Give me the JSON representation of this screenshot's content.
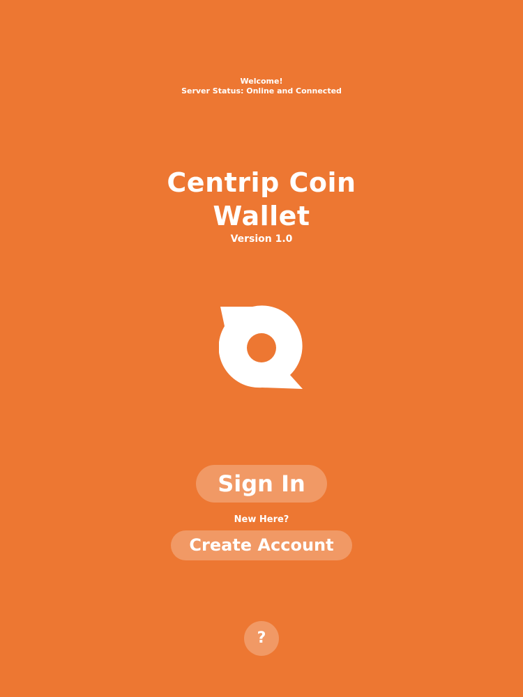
{
  "header": {
    "welcome": "Welcome!",
    "server_status": "Server Status: Online and Connected"
  },
  "app": {
    "title_line1": "Centrip Coin",
    "title_line2": "Wallet",
    "version": "Version 1.0",
    "logo_icon": "centrip-coin-logo-icon"
  },
  "actions": {
    "sign_in": "Sign In",
    "new_here": "New Here?",
    "create_account": "Create Account",
    "help": "?"
  },
  "colors": {
    "background": "#ED7732",
    "foreground": "#FFFFFF",
    "button_fill": "rgba(255,255,255,0.25)"
  }
}
